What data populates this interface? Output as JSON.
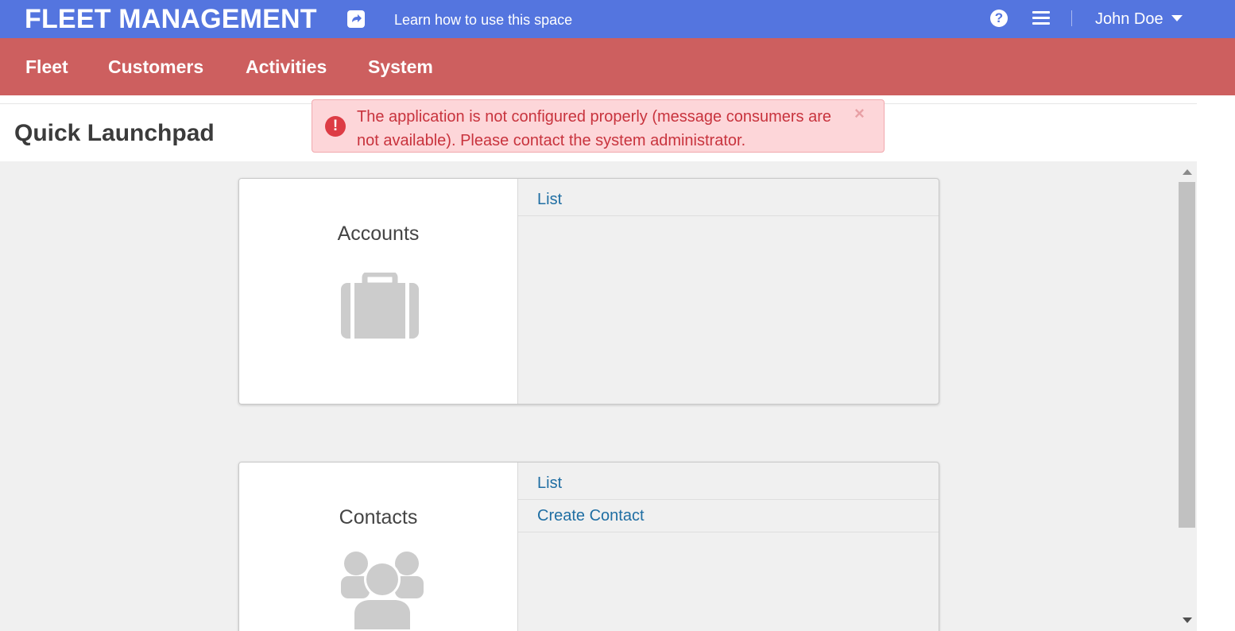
{
  "header": {
    "app_title": "FLEET MANAGEMENT",
    "share_icon": "external-link-icon",
    "learn_link": "Learn how to use this space",
    "help_icon": "?",
    "user_name": "John Doe",
    "background_color": "#5475df"
  },
  "nav": {
    "background_color": "#cd5f5f",
    "items": [
      {
        "label": "Fleet"
      },
      {
        "label": "Customers"
      },
      {
        "label": "Activities"
      },
      {
        "label": "System"
      }
    ]
  },
  "page": {
    "title": "Quick Launchpad"
  },
  "alert": {
    "icon": "!",
    "message": "The application is not configured properly (message consumers are not available). Please contact the system administrator.",
    "close": "×"
  },
  "cards": [
    {
      "title": "Accounts",
      "icon": "briefcase-icon",
      "links": [
        "List"
      ]
    },
    {
      "title": "Contacts",
      "icon": "users-group-icon",
      "links": [
        "List",
        "Create Contact"
      ]
    }
  ]
}
